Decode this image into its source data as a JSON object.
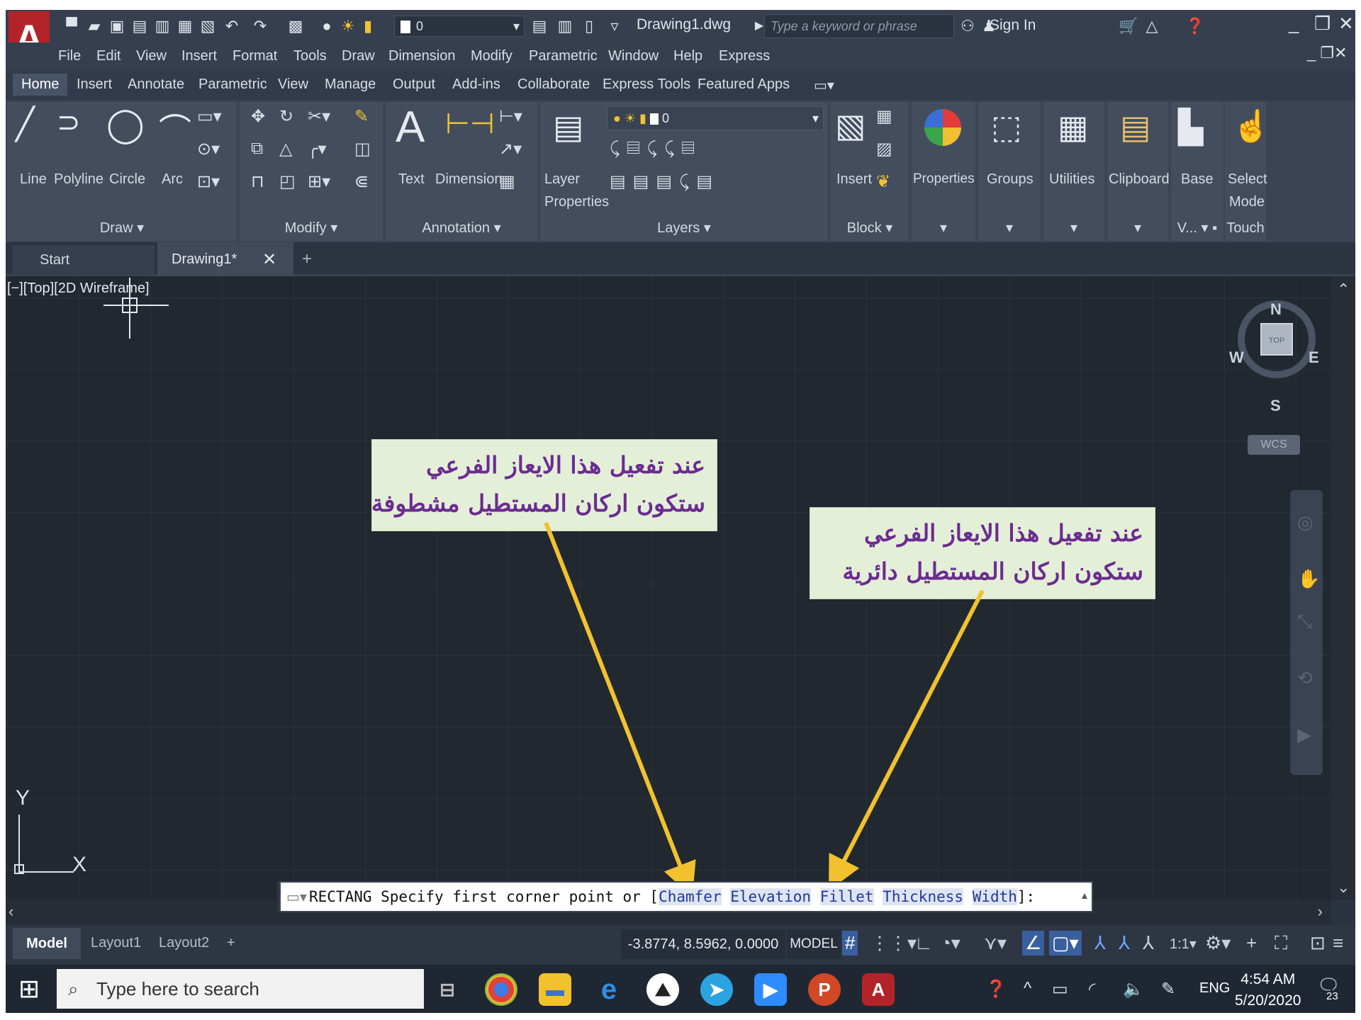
{
  "app": {
    "logo": "A",
    "document_title": "Drawing1.dwg",
    "search_placeholder": "Type a keyword or phrase",
    "sign_in": "Sign In",
    "quick_layer_value": "0"
  },
  "menu": [
    "File",
    "Edit",
    "View",
    "Insert",
    "Format",
    "Tools",
    "Draw",
    "Dimension",
    "Modify",
    "Parametric",
    "Window",
    "Help",
    "Express"
  ],
  "ribbon_tabs": [
    "Home",
    "Insert",
    "Annotate",
    "Parametric",
    "View",
    "Manage",
    "Output",
    "Add-ins",
    "Collaborate",
    "Express Tools",
    "Featured Apps"
  ],
  "ribbon": {
    "draw": {
      "title": "Draw",
      "line": "Line",
      "polyline": "Polyline",
      "circle": "Circle",
      "arc": "Arc"
    },
    "modify": {
      "title": "Modify"
    },
    "annotation": {
      "title": "Annotation",
      "text": "Text",
      "dimension": "Dimension"
    },
    "layers": {
      "title": "Layers",
      "layer_properties_1": "Layer",
      "layer_properties_2": "Properties",
      "layer_value": "0"
    },
    "block": {
      "title": "Block",
      "insert": "Insert"
    },
    "properties": "Properties",
    "groups": "Groups",
    "utilities": "Utilities",
    "clipboard": "Clipboard",
    "base": "Base",
    "view_short": "V...",
    "select_mode_1": "Select",
    "select_mode_2": "Mode",
    "touch": "Touch"
  },
  "file_tabs": {
    "start": "Start",
    "drawing": "Drawing1*"
  },
  "viewport": {
    "label": "[−][Top][2D Wireframe]",
    "compass": {
      "n": "N",
      "s": "S",
      "e": "E",
      "w": "W",
      "top": "TOP"
    },
    "wcs": "WCS",
    "ucs_x": "X",
    "ucs_y": "Y"
  },
  "callouts": [
    {
      "line1": "عند تفعيل هذا الايعاز الفرعي",
      "line2": "ستكون اركان المستطيل مشطوفة"
    },
    {
      "line1": "عند تفعيل هذا الايعاز الفرعي",
      "line2": "ستكون اركان المستطيل دائرية"
    }
  ],
  "command_line": {
    "prefix": "RECTANG Specify first corner point or [",
    "options": [
      "Chamfer",
      "Elevation",
      "Fillet",
      "Thickness",
      "Width"
    ],
    "suffix": "]:"
  },
  "status": {
    "model_tab": "Model",
    "layout_tabs": [
      "Layout1",
      "Layout2"
    ],
    "coordinates": "-3.8774, 8.5962, 0.0000",
    "model_flag": "MODEL",
    "scale": "1:1"
  },
  "taskbar": {
    "search_placeholder": "Type here to search",
    "lang": "ENG",
    "time": "4:54 AM",
    "date": "5/20/2020",
    "notifications": "23"
  },
  "colors": {
    "callout_text": "#6b2c91",
    "callout_bg": "#e4efd7",
    "arrow": "#f2c12e",
    "option_text": "#1f3a9a",
    "logo_red": "#b3242a"
  }
}
